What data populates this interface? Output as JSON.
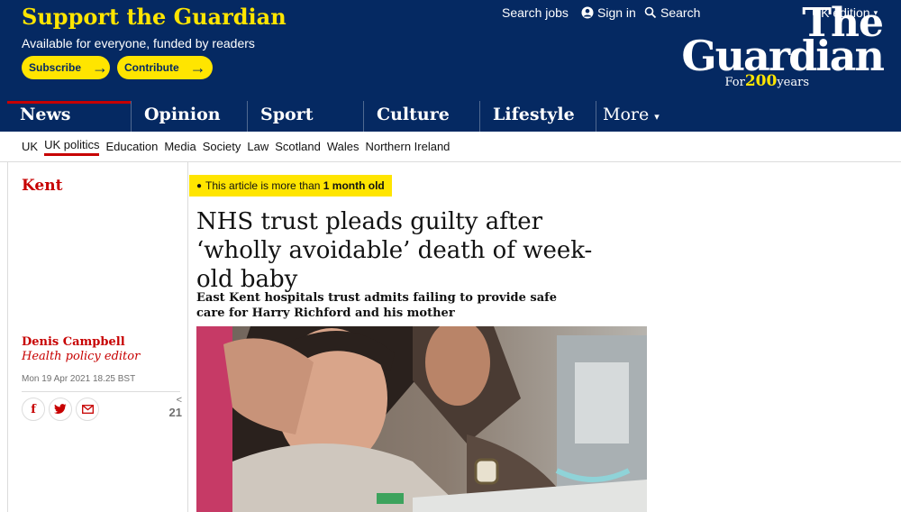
{
  "support": {
    "title": "Support the Guardian",
    "subtitle": "Available for everyone, funded by readers",
    "subscribe_label": "Subscribe",
    "contribute_label": "Contribute"
  },
  "top_links": {
    "search_jobs": "Search jobs",
    "sign_in": "Sign in",
    "search": "Search",
    "edition": "UK edition"
  },
  "logo": {
    "line1": "The",
    "line2": "Guardian",
    "tag_pre": "For",
    "tag_num": "200",
    "tag_post": "years"
  },
  "nav": {
    "items": [
      {
        "label": "News",
        "active": true
      },
      {
        "label": "Opinion"
      },
      {
        "label": "Sport"
      },
      {
        "label": "Culture"
      },
      {
        "label": "Lifestyle"
      }
    ],
    "more_label": "More"
  },
  "subnav": [
    "UK",
    "UK politics",
    "Education",
    "Media",
    "Society",
    "Law",
    "Scotland",
    "Wales",
    "Northern Ireland"
  ],
  "article": {
    "section": "Kent",
    "age_notice_prefix": "This article is more than ",
    "age_notice_bold": "1 month old",
    "headline": "NHS trust pleads guilty after ‘wholly avoidable’ death of week-old baby",
    "standfirst": "East Kent hospitals trust admits failing to provide safe care for Harry Richford and his mother",
    "author": "Denis Campbell",
    "author_role": "Health policy editor",
    "date": "Mon 19 Apr 2021 18.25 BST",
    "share_count": "21"
  },
  "colors": {
    "brand_blue": "#052962",
    "accent_yellow": "#ffe500",
    "news_red": "#c70000"
  }
}
